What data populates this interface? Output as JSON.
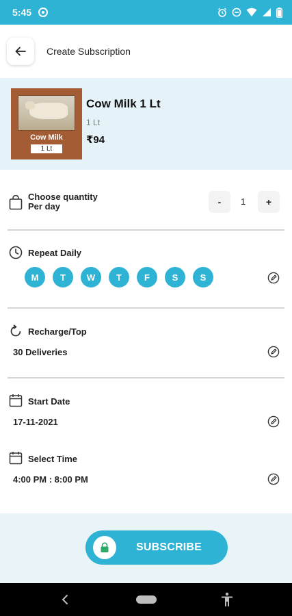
{
  "status_bar": {
    "time": "5:45"
  },
  "header": {
    "title": "Create Subscription"
  },
  "product": {
    "name": "Cow Milk 1 Lt",
    "unit": "1 Lt",
    "price": "₹94",
    "image_label": "Cow Milk",
    "image_sublabel": "1 Lt"
  },
  "quantity": {
    "label_line1": "Choose quantity",
    "label_line2": "Per day",
    "decrement": "-",
    "value": "1",
    "increment": "+"
  },
  "repeat": {
    "label": "Repeat Daily",
    "days": [
      "M",
      "T",
      "W",
      "T",
      "F",
      "S",
      "S"
    ]
  },
  "recharge": {
    "label": "Recharge/Top",
    "value": "30 Deliveries"
  },
  "start_date": {
    "label": "Start Date",
    "value": "17-11-2021"
  },
  "select_time": {
    "label": "Select Time",
    "value": "4:00 PM : 8:00 PM"
  },
  "subscribe_button": {
    "label": "SUBSCRIBE"
  },
  "colors": {
    "accent": "#2fb3d4",
    "product_bg": "#e5f3f8",
    "bottom_bg": "#e8f4f8"
  }
}
